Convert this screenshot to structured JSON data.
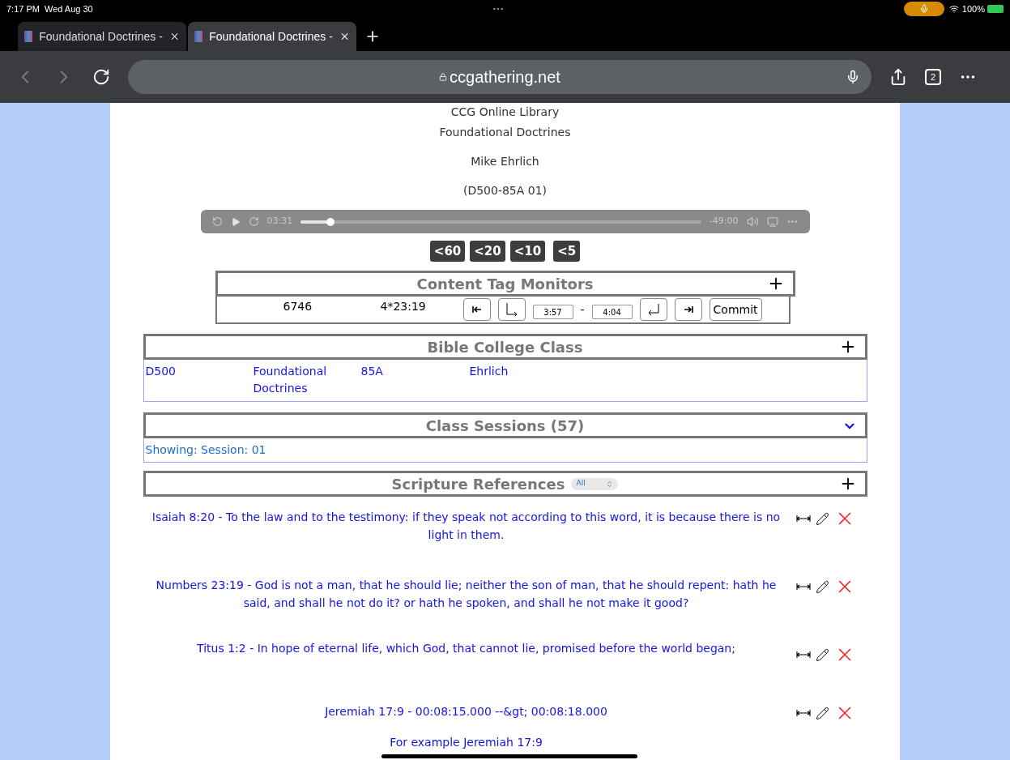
{
  "status_bar": {
    "time": "7:17 PM",
    "date": "Wed Aug 30",
    "battery": "100%"
  },
  "tabs": [
    {
      "label": "Foundational Doctrines -",
      "selected": false
    },
    {
      "label": "Foundational Doctrines -",
      "selected": true
    }
  ],
  "address_bar": {
    "url": "ccgathering.net",
    "tab_count": "2"
  },
  "header": {
    "library": "CCG Online Library",
    "title": "Foundational Doctrines",
    "speaker": "Mike Ehrlich",
    "code": "(D500-85A 01)"
  },
  "player": {
    "elapsed": "03:31",
    "remaining": "-49:00",
    "level": 0.074
  },
  "skip_buttons": [
    "<60",
    "<20",
    "<10",
    "<5"
  ],
  "tag_monitors": {
    "title": "Content Tag Monitors",
    "id": "6746",
    "ref": "4*23:19",
    "start": "3:57",
    "separator": "-",
    "end": "4:04",
    "commit": "Commit"
  },
  "bible_college_class": {
    "title": "Bible College Class",
    "cells": [
      "D500",
      "Foundational Doctrines",
      "85A",
      "Ehrlich"
    ]
  },
  "class_sessions": {
    "title": "Class Sessions (57)",
    "showing": "Showing: Session: 01"
  },
  "scripture_references": {
    "title": "Scripture References",
    "filter": "All",
    "items": [
      {
        "text": "Isaiah 8:20 - To the law and to the testimony: if they speak not according to this word, it is because there is no light in them."
      },
      {
        "text": "Numbers 23:19 - God is not a man, that he should lie; neither the son of man, that he should repent: hath he said, and shall he not do it? or hath he spoken, and shall he not make it good?"
      },
      {
        "text": "Titus 1:2 - In hope of eternal life, which God, that cannot lie, promised before the world began;"
      },
      {
        "text": "Jeremiah 17:9 - 00:08:15.000 --&gt; 00:08:18.000",
        "note": "For example Jeremiah 17:9"
      }
    ]
  }
}
